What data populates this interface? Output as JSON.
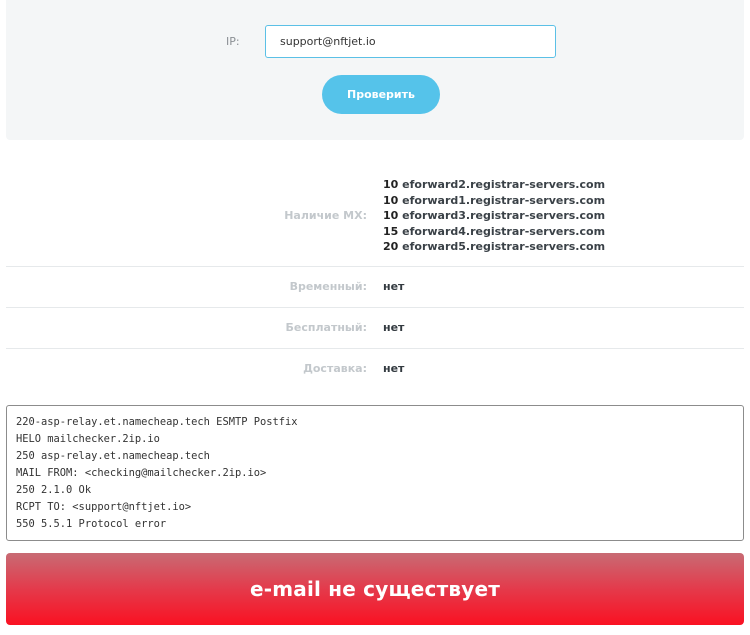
{
  "form": {
    "ip_label": "IP:",
    "ip_value": "support@nftjet.io",
    "check_button": "Проверить"
  },
  "results": {
    "mx_label": "Наличие MX:",
    "mx_records": [
      {
        "priority": "10",
        "host": "eforward2.registrar-servers.com"
      },
      {
        "priority": "10",
        "host": "eforward1.registrar-servers.com"
      },
      {
        "priority": "10",
        "host": "eforward3.registrar-servers.com"
      },
      {
        "priority": "15",
        "host": "eforward4.registrar-servers.com"
      },
      {
        "priority": "20",
        "host": "eforward5.registrar-servers.com"
      }
    ],
    "temporary_label": "Временный:",
    "temporary_value": "нет",
    "free_label": "Бесплатный:",
    "free_value": "нет",
    "delivery_label": "Доставка:",
    "delivery_value": "нет"
  },
  "log": [
    "220-asp-relay.et.namecheap.tech ESMTP Postfix",
    "HELO mailchecker.2ip.io",
    "250 asp-relay.et.namecheap.tech",
    "MAIL FROM: <checking@mailchecker.2ip.io>",
    "250 2.1.0 Ok",
    "RCPT TO: <support@nftjet.io>",
    "550 5.5.1 Protocol error"
  ],
  "verdict": {
    "text": "e-mail не существует",
    "color": "#fa1122"
  },
  "colors": {
    "accent": "#55c3ea",
    "panel_bg": "#f4f6f7"
  }
}
